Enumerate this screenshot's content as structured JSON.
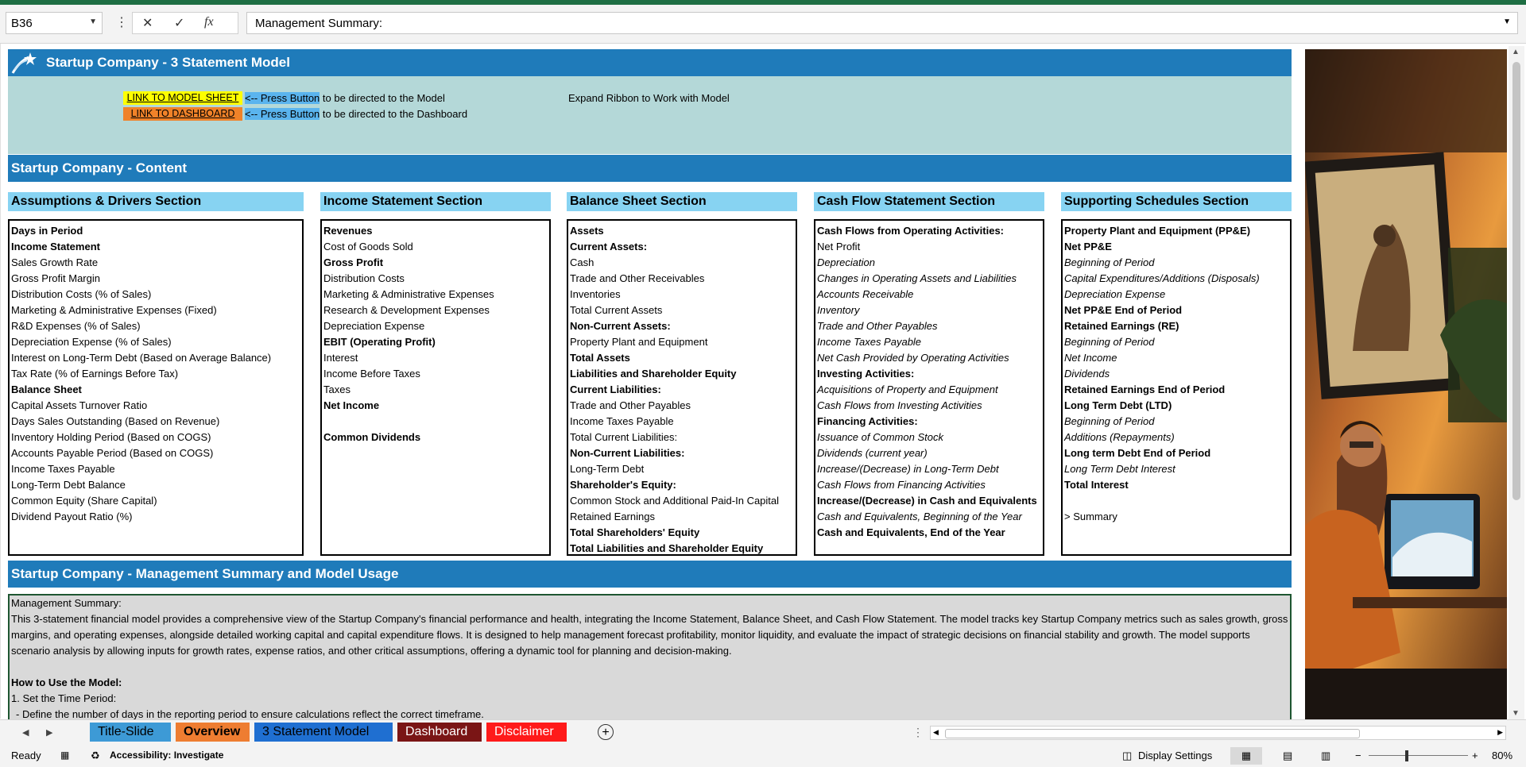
{
  "formula_bar": {
    "cell_ref": "B36",
    "formula": "Management Summary:",
    "fx_label": "fx"
  },
  "header": {
    "title": "Startup Company - 3 Statement Model",
    "link_model_label": "LINK TO MODEL SHEET",
    "link_dashboard_label": "LINK TO DASHBOARD",
    "press_arrow": "<-- Press Button",
    "model_hint": "to be directed to the Model",
    "dashboard_hint": "to be directed to the Dashboard",
    "ribbon_note": "Expand Ribbon to Work with Model"
  },
  "content_title": "Startup Company - Content",
  "sections": [
    {
      "heading": "Assumptions & Drivers Section",
      "items": [
        {
          "text": "Days in Period",
          "style": "b"
        },
        {
          "text": "Income Statement",
          "style": "b"
        },
        {
          "text": "Sales Growth Rate",
          "style": ""
        },
        {
          "text": "Gross Profit Margin",
          "style": ""
        },
        {
          "text": "Distribution Costs (% of Sales)",
          "style": ""
        },
        {
          "text": "Marketing & Administrative Expenses (Fixed)",
          "style": ""
        },
        {
          "text": "R&D Expenses (% of Sales)",
          "style": ""
        },
        {
          "text": "Depreciation Expense (% of Sales)",
          "style": ""
        },
        {
          "text": "Interest on Long-Term Debt (Based on Average Balance)",
          "style": ""
        },
        {
          "text": "Tax Rate (% of Earnings Before Tax)",
          "style": ""
        },
        {
          "text": "Balance Sheet",
          "style": "b"
        },
        {
          "text": "Capital Assets Turnover Ratio",
          "style": ""
        },
        {
          "text": "Days Sales Outstanding (Based on Revenue)",
          "style": ""
        },
        {
          "text": "Inventory Holding Period (Based on COGS)",
          "style": ""
        },
        {
          "text": "Accounts Payable Period (Based on COGS)",
          "style": ""
        },
        {
          "text": "Income Taxes Payable",
          "style": ""
        },
        {
          "text": "Long-Term Debt Balance",
          "style": ""
        },
        {
          "text": "Common Equity (Share Capital)",
          "style": ""
        },
        {
          "text": "Dividend Payout Ratio (%)",
          "style": ""
        }
      ]
    },
    {
      "heading": "Income Statement Section",
      "items": [
        {
          "text": "Revenues",
          "style": "b"
        },
        {
          "text": "Cost of Goods Sold",
          "style": ""
        },
        {
          "text": "Gross Profit",
          "style": "b"
        },
        {
          "text": "Distribution Costs",
          "style": ""
        },
        {
          "text": "Marketing & Administrative Expenses",
          "style": ""
        },
        {
          "text": "Research & Development Expenses",
          "style": ""
        },
        {
          "text": "Depreciation Expense",
          "style": ""
        },
        {
          "text": "EBIT (Operating Profit)",
          "style": "b"
        },
        {
          "text": "Interest",
          "style": ""
        },
        {
          "text": "Income Before Taxes",
          "style": ""
        },
        {
          "text": "Taxes",
          "style": ""
        },
        {
          "text": "Net Income",
          "style": "b"
        },
        {
          "text": "",
          "style": ""
        },
        {
          "text": "Common Dividends",
          "style": "b"
        }
      ]
    },
    {
      "heading": "Balance Sheet Section",
      "items": [
        {
          "text": "Assets",
          "style": "b"
        },
        {
          "text": "Current Assets:",
          "style": "b"
        },
        {
          "text": "Cash",
          "style": ""
        },
        {
          "text": "Trade and Other Receivables",
          "style": ""
        },
        {
          "text": "Inventories",
          "style": ""
        },
        {
          "text": "Total Current Assets",
          "style": ""
        },
        {
          "text": "Non-Current Assets:",
          "style": "b"
        },
        {
          "text": "Property Plant and Equipment",
          "style": ""
        },
        {
          "text": "Total Assets",
          "style": "b"
        },
        {
          "text": "Liabilities and Shareholder Equity",
          "style": "b"
        },
        {
          "text": "Current Liabilities:",
          "style": "b"
        },
        {
          "text": "Trade and Other Payables",
          "style": ""
        },
        {
          "text": "Income Taxes Payable",
          "style": ""
        },
        {
          "text": "Total Current Liabilities:",
          "style": ""
        },
        {
          "text": "Non-Current Liabilities:",
          "style": "b"
        },
        {
          "text": "Long-Term Debt",
          "style": ""
        },
        {
          "text": "Shareholder's Equity:",
          "style": "b"
        },
        {
          "text": "Common Stock and Additional Paid-In Capital",
          "style": ""
        },
        {
          "text": "Retained Earnings",
          "style": ""
        },
        {
          "text": "Total Shareholders' Equity",
          "style": "b"
        },
        {
          "text": "Total Liabilities and Shareholder Equity",
          "style": "b"
        }
      ]
    },
    {
      "heading": "Cash Flow Statement Section",
      "items": [
        {
          "text": "Cash Flows from Operating Activities:",
          "style": "b"
        },
        {
          "text": "Net Profit",
          "style": ""
        },
        {
          "text": "Depreciation",
          "style": "i"
        },
        {
          "text": "Changes in Operating Assets and Liabilities",
          "style": "i"
        },
        {
          "text": "Accounts Receivable",
          "style": "i"
        },
        {
          "text": "Inventory",
          "style": "i"
        },
        {
          "text": "Trade and Other Payables",
          "style": "i"
        },
        {
          "text": "Income Taxes Payable",
          "style": "i"
        },
        {
          "text": "Net Cash Provided by Operating Activities",
          "style": "i"
        },
        {
          "text": "Investing Activities:",
          "style": "b"
        },
        {
          "text": "Acquisitions of Property and Equipment",
          "style": "i"
        },
        {
          "text": "Cash Flows from Investing Activities",
          "style": "i"
        },
        {
          "text": "Financing Activities:",
          "style": "b"
        },
        {
          "text": "Issuance of Common Stock",
          "style": "i"
        },
        {
          "text": "Dividends (current year)",
          "style": "i"
        },
        {
          "text": "Increase/(Decrease) in Long-Term Debt",
          "style": "i"
        },
        {
          "text": "Cash Flows from Financing Activities",
          "style": "i"
        },
        {
          "text": "Increase/(Decrease) in Cash and Equivalents",
          "style": "b"
        },
        {
          "text": "Cash and Equivalents, Beginning of the Year",
          "style": "i"
        },
        {
          "text": "Cash and Equivalents, End of the Year",
          "style": "b"
        }
      ]
    },
    {
      "heading": "Supporting Schedules Section",
      "items": [
        {
          "text": "Property Plant and Equipment (PP&E)",
          "style": "b"
        },
        {
          "text": "Net PP&E",
          "style": "b"
        },
        {
          "text": "Beginning of Period",
          "style": "i"
        },
        {
          "text": "Capital Expenditures/Additions (Disposals)",
          "style": "i"
        },
        {
          "text": "Depreciation Expense",
          "style": "i"
        },
        {
          "text": "Net PP&E End of Period",
          "style": "b"
        },
        {
          "text": "Retained Earnings (RE)",
          "style": "b"
        },
        {
          "text": "Beginning of Period",
          "style": "i"
        },
        {
          "text": "Net Income",
          "style": "i"
        },
        {
          "text": "Dividends",
          "style": "i"
        },
        {
          "text": "Retained Earnings End of Period",
          "style": "b"
        },
        {
          "text": "Long Term Debt (LTD)",
          "style": "b"
        },
        {
          "text": "Beginning of Period",
          "style": "i"
        },
        {
          "text": "Additions (Repayments)",
          "style": "i"
        },
        {
          "text": "Long term Debt End of Period",
          "style": "b"
        },
        {
          "text": "Long Term Debt Interest",
          "style": "i"
        },
        {
          "text": "Total Interest",
          "style": "b"
        },
        {
          "text": "",
          "style": ""
        },
        {
          "text": "> Summary",
          "style": ""
        }
      ]
    }
  ],
  "summary_title": "Startup Company - Management Summary and Model Usage",
  "summary": {
    "label": "Management Summary:",
    "body": "This 3-statement financial model provides a comprehensive view of the Startup Company's financial performance and health, integrating the Income Statement, Balance Sheet, and Cash Flow Statement. The model tracks key Startup Company metrics such as sales growth, gross margins, and operating expenses, alongside detailed working capital and capital expenditure flows. It is designed to help management forecast profitability, monitor liquidity, and evaluate the impact of strategic decisions on financial stability and growth. The model supports scenario analysis by allowing inputs for growth rates, expense ratios, and other critical assumptions, offering a dynamic tool for planning and decision-making.",
    "howto_title": "How to Use the Model:",
    "step1": "1. Set the Time Period:",
    "step1_detail": "- Define the number of days in the reporting period to ensure calculations reflect the correct timeframe."
  },
  "tabs": [
    {
      "label": "Title-Slide",
      "bg": "#3d9ad6",
      "color": "#000000"
    },
    {
      "label": "Overview",
      "bg": "#ee7d31",
      "color": "#000000"
    },
    {
      "label": "3 Statement Model",
      "bg": "#1f6fd1",
      "color": "#000000"
    },
    {
      "label": "Dashboard",
      "bg": "#7a1515",
      "color": "#ffffff"
    },
    {
      "label": "Disclaimer",
      "bg": "#ff1a1a",
      "color": "#ffffff"
    }
  ],
  "status": {
    "ready": "Ready",
    "accessibility": "Accessibility: Investigate",
    "display_settings": "Display Settings",
    "zoom": "80%"
  },
  "colors": {
    "header_blue": "#1f7bba",
    "link_area": "#b4d8d8",
    "section_heading": "#87d3f2",
    "model_button": "#ffff00",
    "dashboard_button": "#f08229"
  }
}
